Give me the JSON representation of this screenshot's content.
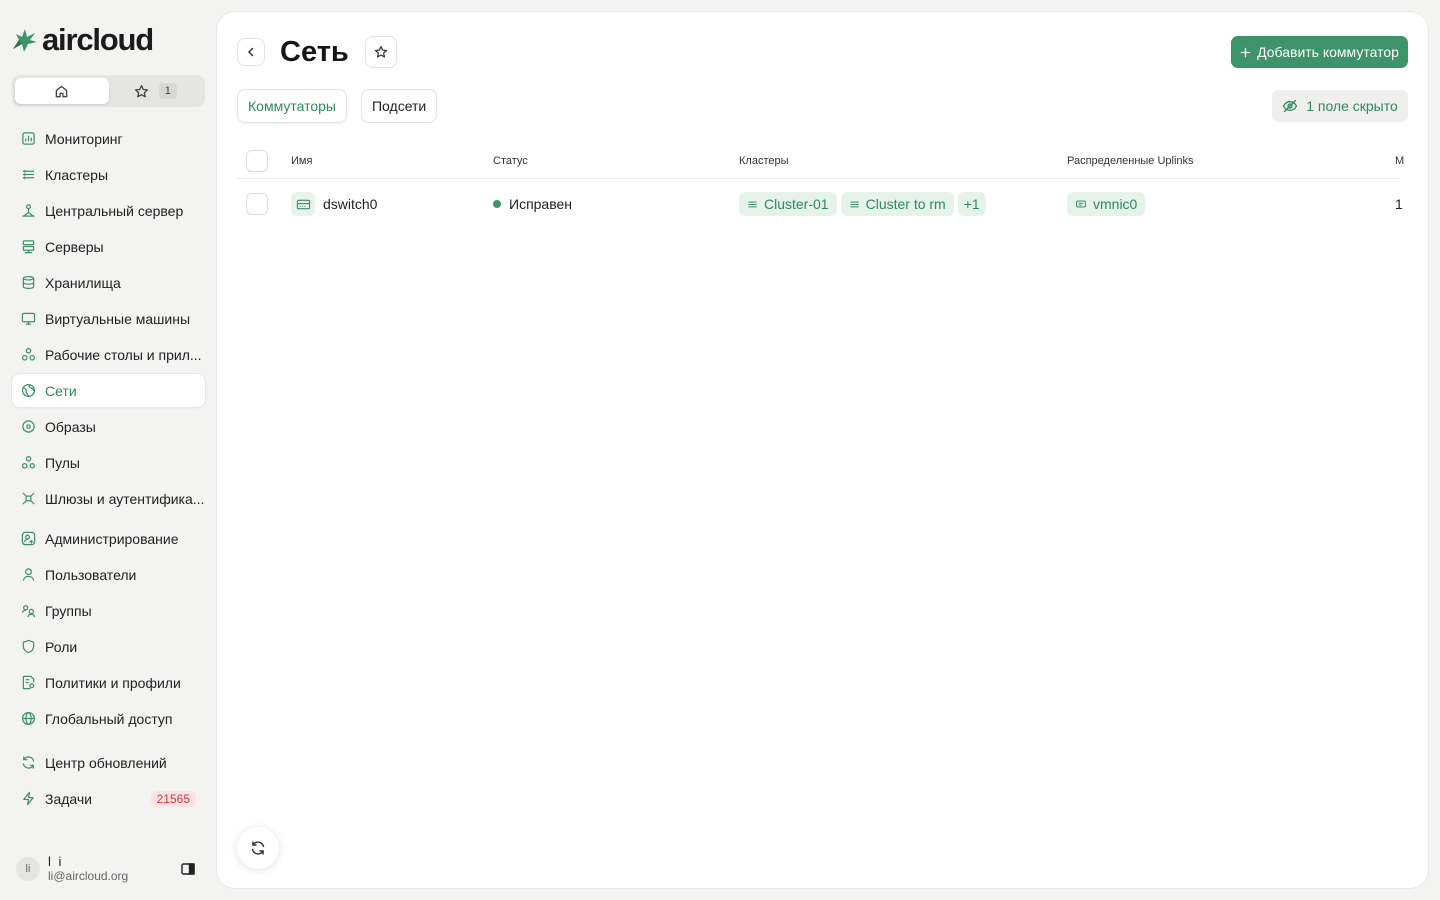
{
  "brand": {
    "name": "aircloud",
    "accent": "#3d9468"
  },
  "fav_switch": {
    "home_icon": "home-icon",
    "star_icon": "star-icon",
    "fav_count": "1"
  },
  "sidebar": {
    "items": [
      {
        "label": "Мониторинг",
        "icon": "chart-icon"
      },
      {
        "label": "Кластеры",
        "icon": "layers-icon"
      },
      {
        "label": "Центральный сервер",
        "icon": "network-icon"
      },
      {
        "label": "Серверы",
        "icon": "server-icon"
      },
      {
        "label": "Хранилища",
        "icon": "database-icon"
      },
      {
        "label": "Виртуальные машины",
        "icon": "monitor-icon"
      },
      {
        "label": "Рабочие столы и прил...",
        "icon": "apps-icon"
      },
      {
        "label": "Сети",
        "icon": "globe-net-icon"
      },
      {
        "label": "Образы",
        "icon": "disc-icon"
      },
      {
        "label": "Пулы",
        "icon": "pools-icon"
      },
      {
        "label": "Шлюзы и аутентифика...",
        "icon": "gateway-icon"
      },
      {
        "label": "Администрирование",
        "icon": "admin-icon"
      },
      {
        "label": "Пользователи",
        "icon": "user-icon"
      },
      {
        "label": "Группы",
        "icon": "group-icon"
      },
      {
        "label": "Роли",
        "icon": "shield-icon"
      },
      {
        "label": "Политики и профили",
        "icon": "policy-icon"
      },
      {
        "label": "Глобальный доступ",
        "icon": "globe-icon"
      },
      {
        "label": "Центр обновлений",
        "icon": "refresh-icon"
      },
      {
        "label": "Задачи",
        "icon": "bolt-icon",
        "badge": "21565"
      }
    ]
  },
  "user": {
    "avatar": "li",
    "name": "l i",
    "email": "li@aircloud.org"
  },
  "page": {
    "title": "Сеть",
    "add_button": "Добавить коммутатор",
    "tabs": [
      "Коммутаторы",
      "Подсети"
    ],
    "hidden_fields": "1 поле скрыто"
  },
  "table": {
    "columns": [
      "Имя",
      "Статус",
      "Кластеры",
      "Распределенные Uplinks",
      "M"
    ],
    "rows": [
      {
        "name": "dswitch0",
        "status": "Исправен",
        "clusters": [
          "Cluster-01",
          "Cluster to rm"
        ],
        "clusters_more": "+1",
        "uplinks": [
          "vmnic0"
        ],
        "last": "1"
      }
    ]
  }
}
